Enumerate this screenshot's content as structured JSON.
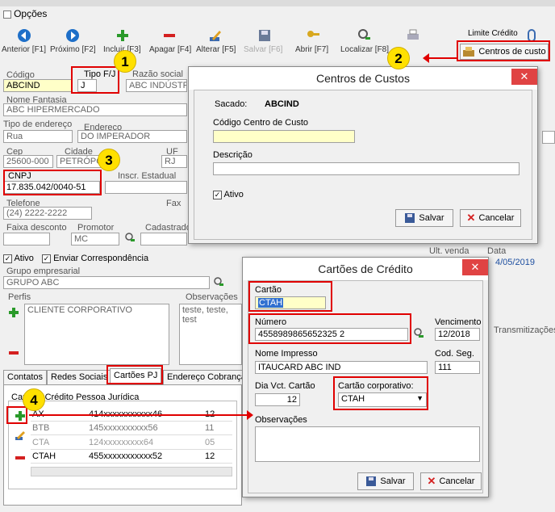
{
  "window": {
    "title": "Opções"
  },
  "toolbar": {
    "items": [
      {
        "label": "Anterior [F1]"
      },
      {
        "label": "Próximo [F2]"
      },
      {
        "label": "Incluir [F3]"
      },
      {
        "label": "Apagar [F4]"
      },
      {
        "label": "Alterar [F5]"
      },
      {
        "label": "Salvar [F6]"
      },
      {
        "label": "Abrir [F7]"
      },
      {
        "label": "Localizar [F8]"
      },
      {
        "label": "Limite Crédito"
      },
      {
        "label": "Centros de custo"
      }
    ]
  },
  "form": {
    "codigo_label": "Código",
    "codigo_value": "ABCIND",
    "tipo_label": "Tipo F/J",
    "tipo_value": "J",
    "razao_label": "Razão social",
    "razao_value": "ABC INDÚSTR",
    "fantasia_label": "Nome Fantasia",
    "fantasia_value": "ABC HIPERMERCADO",
    "tipo_end_label": "Tipo de endereço",
    "tipo_end_value": "Rua",
    "endereco_label": "Endereço",
    "endereco_value": "DO IMPERADOR",
    "cep_label": "Cep",
    "cep_value": "25600-000",
    "cidade_label": "Cidade",
    "cidade_value": "PETRÓPOLIS",
    "uf_label": "UF",
    "uf_value": "RJ",
    "cnpj_label": "CNPJ",
    "cnpj_value": "17.835.042/0040-51",
    "ie_label": "Inscr. Estadual",
    "telefone_label": "Telefone",
    "telefone_value": "(24) 2222-2222",
    "fax_label": "Fax",
    "faixa_label": "Faixa desconto",
    "promotor_label": "Promotor",
    "promotor_value": "MC",
    "cadastrado_label": "Cadastrado",
    "ativo_label": "Ativo",
    "enviar_label": "Enviar Correspondência",
    "grupo_label": "Grupo empresarial",
    "grupo_value": "GRUPO ABC",
    "perfis_label": "Perfis",
    "perfis_item": "CLIENTE CORPORATIVO",
    "obs_label": "Observações",
    "obs_value": "teste, teste, test",
    "ult_venda_label": "Ult. venda",
    "data_label": "Data",
    "data_value": "4/05/2019",
    "transmissao_label": "Transmitizações"
  },
  "tabs": [
    {
      "label": "Contatos"
    },
    {
      "label": "Redes Sociais"
    },
    {
      "label": "Cartões PJ"
    },
    {
      "label": "Endereço Cobrança"
    }
  ],
  "cards_panel": {
    "title": "Cartões Crédito Pessoa Jurídica",
    "rows": [
      {
        "c1": "AX",
        "c2": "414xxxxxxxxxxx46",
        "c3": "12"
      },
      {
        "c1": "BTB",
        "c2": "145xxxxxxxxxx56",
        "c3": "11"
      },
      {
        "c1": "CTA",
        "c2": "124xxxxxxxxx64",
        "c3": "05"
      },
      {
        "c1": "CTAH",
        "c2": "455xxxxxxxxxxx52",
        "c3": "12"
      }
    ]
  },
  "dlg_custos": {
    "title": "Centros de Custos",
    "sacado_label": "Sacado:",
    "sacado_value": "ABCIND",
    "codigo_label": "Código Centro de Custo",
    "codigo_value": "",
    "descricao_label": "Descrição",
    "descricao_value": "",
    "ativo_label": "Ativo",
    "salvar": "Salvar",
    "cancelar": "Cancelar"
  },
  "dlg_cartoes": {
    "title": "Cartões de Crédito",
    "cartao_label": "Cartão",
    "cartao_value": "CTAH",
    "numero_label": "Número",
    "numero_value": "4558989865652325 2",
    "vencimento_label": "Vencimento",
    "vencimento_value": "12/2018",
    "nome_label": "Nome Impresso",
    "nome_value": "ITAUCARD ABC IND",
    "cod_label": "Cod. Seg.",
    "cod_value": "111",
    "dia_label": "Dia Vct. Cartão",
    "dia_value": "12",
    "corp_label": "Cartão corporativo:",
    "corp_value": "CTAH",
    "obs_label": "Observações",
    "salvar": "Salvar",
    "cancelar": "Cancelar"
  },
  "badges": [
    "1",
    "2",
    "3",
    "4"
  ],
  "colors": {
    "highlight": "#e00000",
    "badge": "#ffe000",
    "accent": "#1e6fc8"
  }
}
